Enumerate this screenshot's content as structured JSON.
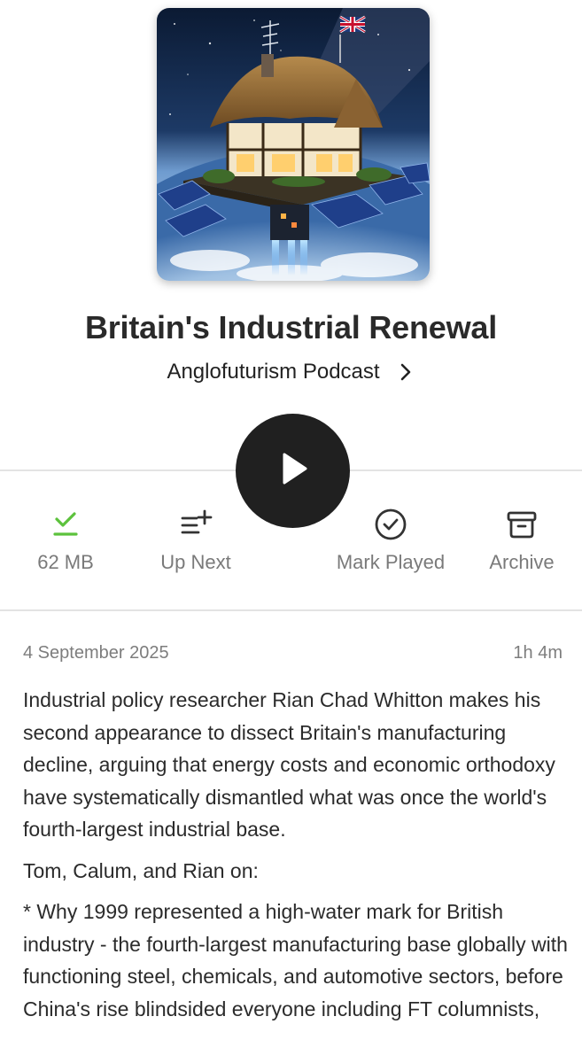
{
  "episode": {
    "title": "Britain's Industrial Renewal",
    "podcast_name": "Anglofuturism Podcast",
    "date": "4 September 2025",
    "duration": "1h 4m"
  },
  "actions": {
    "download_label": "62 MB",
    "up_next_label": "Up Next",
    "mark_played_label": "Mark Played",
    "archive_label": "Archive"
  },
  "description": {
    "paragraph_1": "Industrial policy researcher Rian Chad Whitton makes his second appearance to dissect Britain's manufacturing decline, arguing that energy costs and economic orthodoxy have systematically dismantled what was once the world's fourth-largest industrial base.",
    "paragraph_2": "Tom, Calum, and Rian on:",
    "paragraph_3": "* Why 1999 represented a high-water mark for British industry - the fourth-largest manufacturing base globally with functioning steel, chemicals, and automotive sectors, before China's rise blindsided everyone including FT columnists,"
  },
  "colors": {
    "download_done": "#5cc23c",
    "play_button": "#202020",
    "icon_gray": "#333333",
    "muted_text": "#7a7a7a"
  },
  "icons": {
    "play": "play-icon",
    "download": "download-check-icon",
    "up_next": "queue-add-icon",
    "mark_played": "check-circle-icon",
    "archive": "archive-box-icon",
    "podcast_chevron": "chevron-right-icon"
  }
}
